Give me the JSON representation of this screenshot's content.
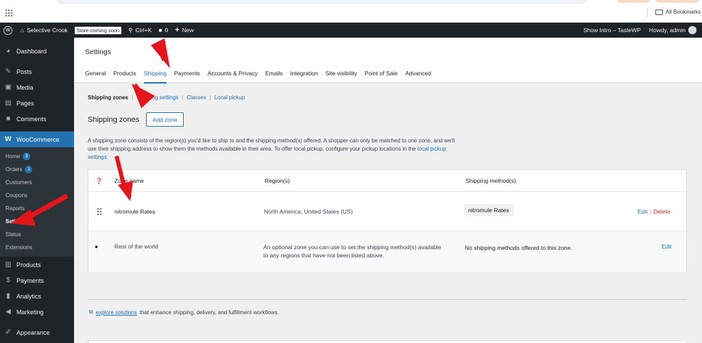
{
  "browser": {
    "bookmarks_label": "All Bookmarks"
  },
  "adminbar": {
    "site_name": "Selective Crook",
    "store_badge": "Store coming soon",
    "search_shortcut": "Ctrl+K",
    "comments_count": "0",
    "new_label": "New",
    "show_intro": "Show Intro – TasteWP",
    "howdy": "Howdy, admin"
  },
  "sidebar": {
    "items": [
      {
        "label": "Dashboard",
        "icon": "dashboard-icon"
      },
      {
        "label": "Posts",
        "icon": "pin-icon"
      },
      {
        "label": "Media",
        "icon": "media-icon"
      },
      {
        "label": "Pages",
        "icon": "page-icon"
      },
      {
        "label": "Comments",
        "icon": "comment-icon"
      },
      {
        "label": "WooCommerce",
        "icon": "woo-icon"
      }
    ],
    "woo_sub": [
      {
        "label": "Home",
        "badge": "3"
      },
      {
        "label": "Orders",
        "badge": "1"
      },
      {
        "label": "Customers"
      },
      {
        "label": "Coupons"
      },
      {
        "label": "Reports"
      },
      {
        "label": "Settings"
      },
      {
        "label": "Status"
      },
      {
        "label": "Extensions"
      }
    ],
    "bottom_items": [
      {
        "label": "Products",
        "icon": "products-icon"
      },
      {
        "label": "Payments",
        "icon": "payments-icon"
      },
      {
        "label": "Analytics",
        "icon": "analytics-icon"
      },
      {
        "label": "Marketing",
        "icon": "megaphone-icon"
      },
      {
        "label": "Appearance",
        "icon": "brush-icon"
      }
    ]
  },
  "header": {
    "title": "Settings",
    "tabs": [
      "General",
      "Products",
      "Shipping",
      "Payments",
      "Accounts & Privacy",
      "Emails",
      "Integration",
      "Site visibility",
      "Point of Sale",
      "Advanced"
    ]
  },
  "subnav": {
    "current": "Shipping zones",
    "links": [
      "Shipping settings",
      "Classes",
      "Local pickup"
    ]
  },
  "zones": {
    "title": "Shipping zones",
    "add_button": "Add zone",
    "description_1": "A shipping zone consists of the region(s) you'd like to ship to and the shipping method(s) offered. A shopper can only be matched to one zone, and we'll use their shipping address to show them the methods available in their area. To offer local pickup, configure your pickup locations in the ",
    "description_link": "local pickup settings",
    "description_2": "."
  },
  "table": {
    "headers": {
      "name": "Zone name",
      "regions": "Region(s)",
      "methods": "Shipping method(s)"
    },
    "rows": [
      {
        "name": "nitromule Rates",
        "region": "North America, United States (US)",
        "method": "nitromule Rates",
        "edit": "Edit",
        "delete": "Delete"
      },
      {
        "name": "Rest of the world",
        "region": "An optional zone you can use to set the shipping method(s) available to any regions that have not been listed above.",
        "method": "No shipping methods offered to this zone.",
        "edit": "Edit"
      }
    ]
  },
  "footer": {
    "link": "explore solutions",
    "text": " that enhance shipping, delivery, and fulfillment workflows."
  },
  "colors": {
    "accent": "#2271b1",
    "admin_dark": "#1d2327",
    "arrow_red": "#e8141b"
  }
}
